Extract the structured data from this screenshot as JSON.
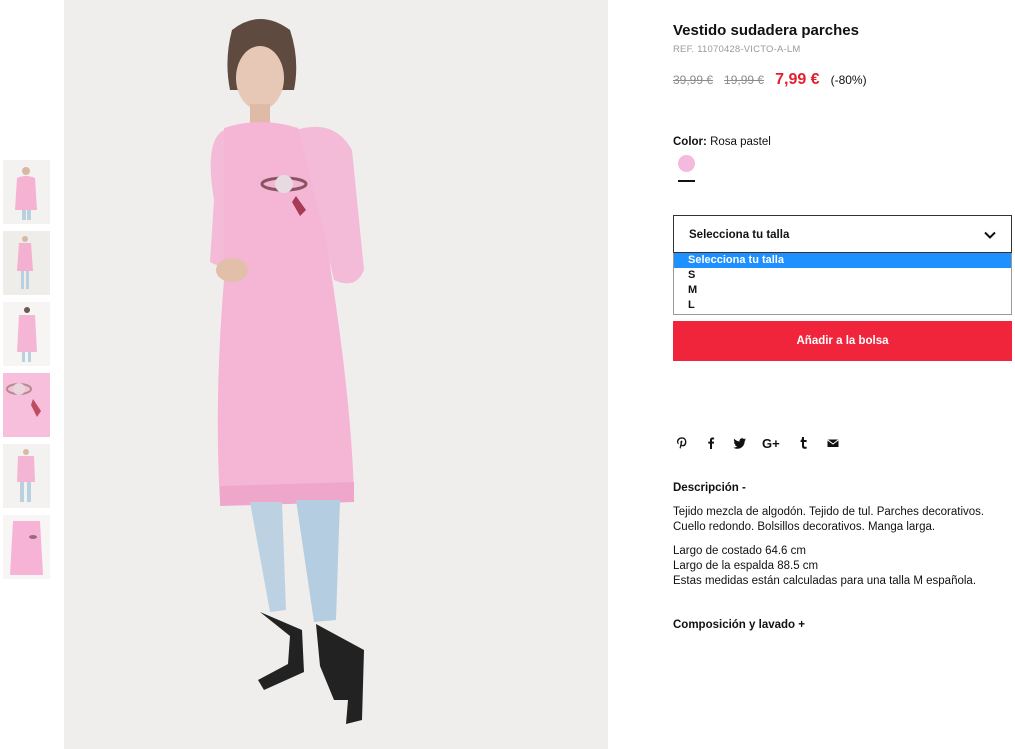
{
  "product": {
    "title": "Vestido sudadera parches",
    "ref": "REF. 11070428-VICTO-A-LM",
    "prices": {
      "original": "39,99 €",
      "previous": "19,99 €",
      "current": "7,99 €",
      "discount": "(-80%)"
    },
    "color": {
      "label": "Color:",
      "value": "Rosa pastel",
      "swatch_color": "#f5b9de"
    }
  },
  "size_select": {
    "value": "Selecciona tu talla",
    "options": [
      "Selecciona tu talla",
      "S",
      "M",
      "L"
    ],
    "selected_index": 0
  },
  "add_button": {
    "label": "Añadir a la bolsa"
  },
  "share": {
    "icons": [
      "pinterest-icon",
      "facebook-icon",
      "twitter-icon",
      "google-plus-icon",
      "tumblr-icon",
      "email-icon"
    ]
  },
  "description": {
    "title": "Descripción  -",
    "paragraph1": "Tejido mezcla de algodón. Tejido de tul. Parches decorativos. Cuello redondo. Bolsillos decorativos. Manga larga.",
    "line1": "Largo de costado 64.6 cm",
    "line2": "Largo de la espalda 88.5 cm",
    "line3": "Estas medidas están calculadas para una talla M española."
  },
  "composition": {
    "title": "Composición y lavado  +"
  },
  "colors": {
    "accent_red": "#f0253b",
    "price_red": "#e5202e",
    "dress_pink": "#f5b9de",
    "select_highlight": "#1e90ff"
  }
}
